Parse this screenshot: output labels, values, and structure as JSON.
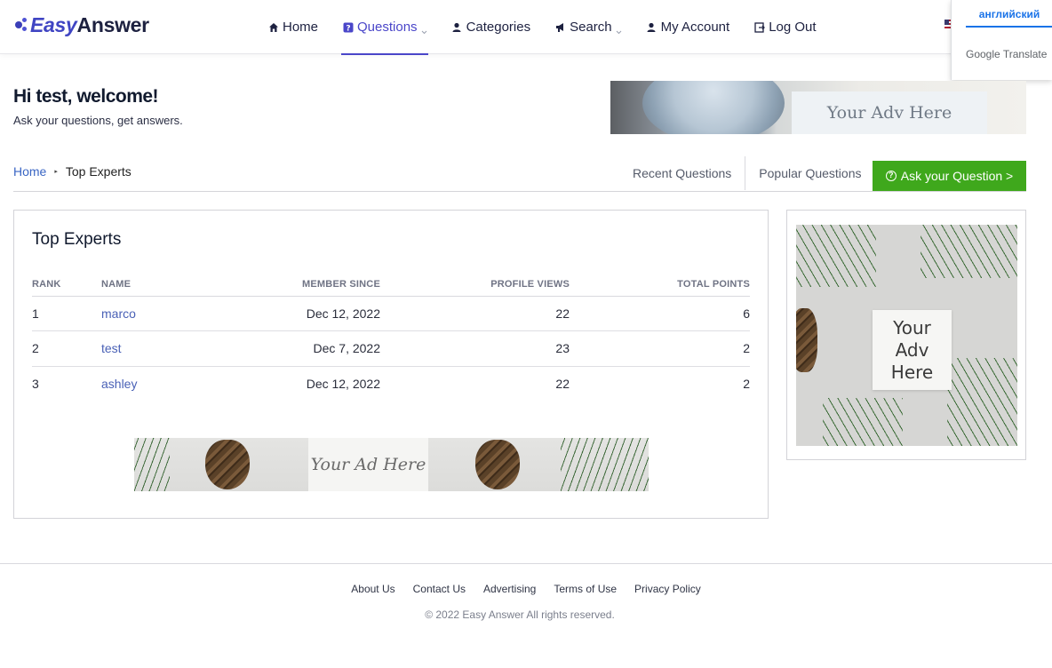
{
  "brand": {
    "easy": "Easy",
    "answer": "Answer"
  },
  "nav": {
    "home": "Home",
    "questions": "Questions",
    "categories": "Categories",
    "search": "Search",
    "account": "My Account",
    "logout": "Log Out"
  },
  "translate": {
    "language": "английский",
    "brand": "Google Translate"
  },
  "welcome": {
    "title": "Hi test, welcome!",
    "subtitle": "Ask your questions, get answers."
  },
  "top_ad": {
    "label": "Your Adv Here"
  },
  "breadcrumb": {
    "home": "Home",
    "current": "Top Experts"
  },
  "tabs": {
    "recent": "Recent Questions",
    "popular": "Popular Questions"
  },
  "ask_button": {
    "label": "Ask your Question >"
  },
  "experts": {
    "title": "Top Experts",
    "columns": {
      "rank": "Rank",
      "name": "Name",
      "since": "Member Since",
      "views": "Profile Views",
      "points": "Total Points"
    },
    "rows": [
      {
        "rank": "1",
        "name": "marco",
        "since": "Dec 12, 2022",
        "views": "22",
        "points": "6"
      },
      {
        "rank": "2",
        "name": "test",
        "since": "Dec 7, 2022",
        "views": "23",
        "points": "2"
      },
      {
        "rank": "3",
        "name": "ashley",
        "since": "Dec 12, 2022",
        "views": "22",
        "points": "2"
      }
    ]
  },
  "bottom_ad": {
    "label": "Your Ad Here"
  },
  "side_ad": {
    "label": "Your\nAdv\nHere"
  },
  "footer": {
    "links": [
      "About Us",
      "Contact Us",
      "Advertising",
      "Terms of Use",
      "Privacy Policy"
    ],
    "copyright": "© 2022 Easy Answer All rights reserved."
  },
  "colors": {
    "accent": "#4a46c9",
    "ask_button": "#3fa81c",
    "link": "#4a61b6"
  }
}
